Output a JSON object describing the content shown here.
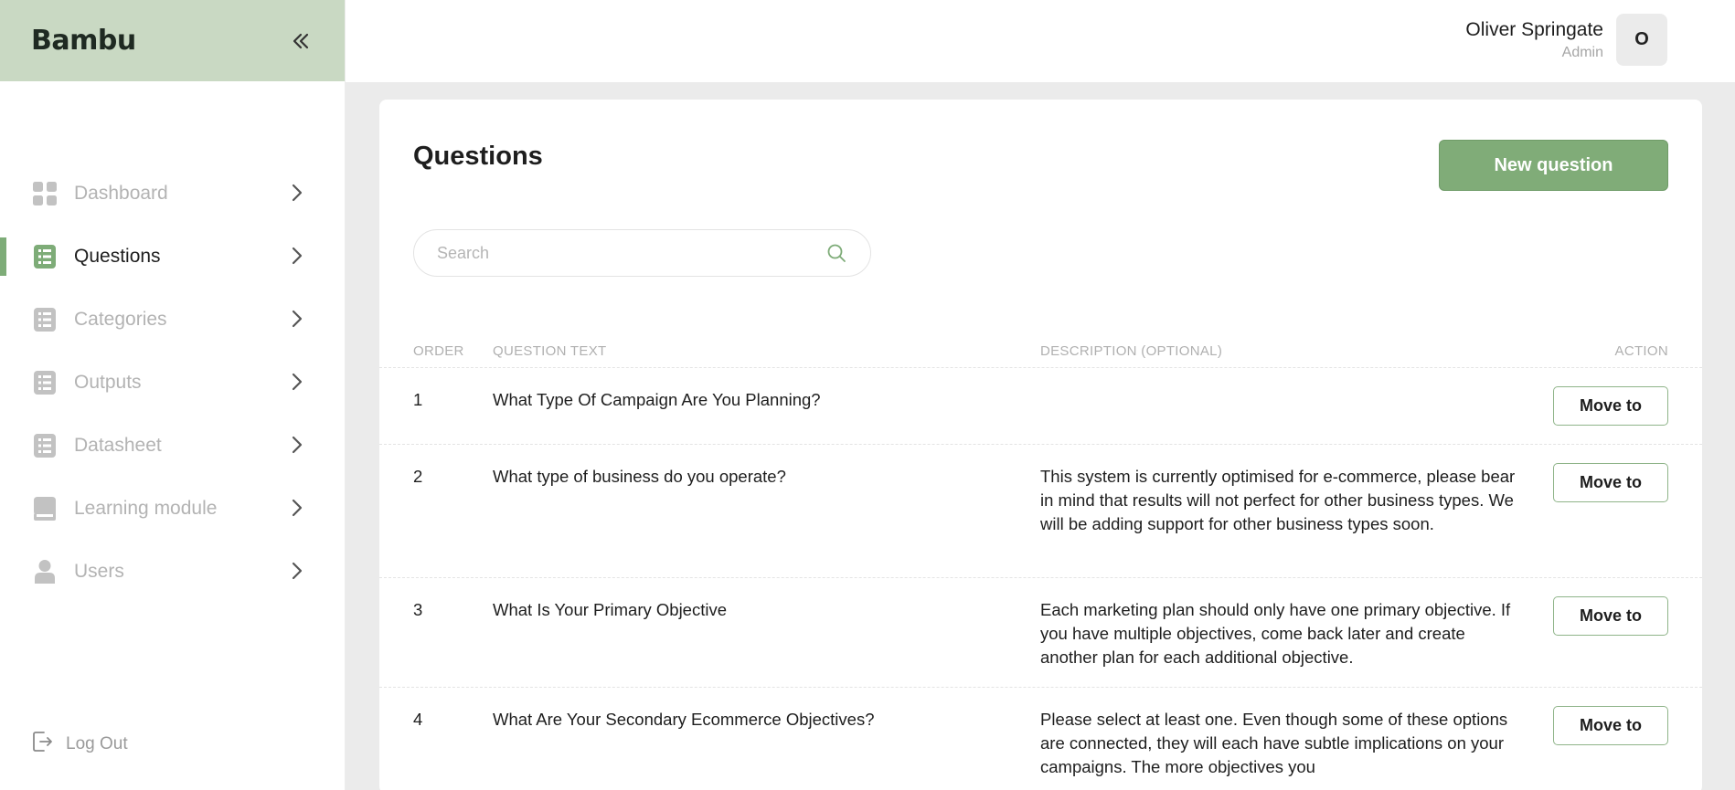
{
  "app": {
    "logo": "Bambu"
  },
  "sidebar": {
    "items": [
      {
        "label": "Dashboard",
        "icon": "dashboard-grid-icon",
        "active": false
      },
      {
        "label": "Questions",
        "icon": "list-icon",
        "active": true
      },
      {
        "label": "Categories",
        "icon": "list-icon",
        "active": false
      },
      {
        "label": "Outputs",
        "icon": "list-icon",
        "active": false
      },
      {
        "label": "Datasheet",
        "icon": "list-icon",
        "active": false
      },
      {
        "label": "Learning module",
        "icon": "book-icon",
        "active": false
      },
      {
        "label": "Users",
        "icon": "user-icon",
        "active": false
      }
    ],
    "logout_label": "Log Out"
  },
  "user": {
    "name": "Oliver Springate",
    "role": "Admin",
    "initial": "O"
  },
  "page": {
    "title": "Questions",
    "new_button": "New question",
    "search_placeholder": "Search"
  },
  "table": {
    "headers": {
      "order": "ORDER",
      "question": "QUESTION TEXT",
      "description": "DESCRIPTION (OPTIONAL)",
      "action": "ACTION"
    },
    "rows": [
      {
        "order": "1",
        "question": "What Type Of Campaign Are You Planning?",
        "description": "",
        "action": "Move to"
      },
      {
        "order": "2",
        "question": "What type of business do you operate?",
        "description": "This system is currently optimised for e-commerce, please bear in mind that results will not perfect for other business types. We will be adding support for other business types soon.",
        "action": "Move to"
      },
      {
        "order": "3",
        "question": "What Is Your Primary Objective",
        "description": "Each marketing plan should only have one primary objective. If you have multiple objectives, come back later and create another plan for each additional objective.",
        "action": "Move to"
      },
      {
        "order": "4",
        "question": "What Are Your Secondary Ecommerce Objectives?",
        "description": "Please select at least one. Even though some of these options are connected, they will each have subtle implications on your campaigns. The more objectives you",
        "action": "Move to"
      }
    ]
  },
  "colors": {
    "brand_bar": "#c9d9c3",
    "accent": "#80ac78",
    "background": "#ebebeb"
  }
}
